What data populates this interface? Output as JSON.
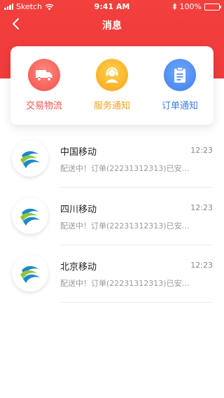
{
  "status_bar": {
    "carrier": "Sketch",
    "time": "9:41 AM",
    "battery": "100%"
  },
  "nav": {
    "title": "消息"
  },
  "categories": [
    {
      "label": "交易物流",
      "icon": "truck-icon",
      "color": "#f0574b"
    },
    {
      "label": "服务通知",
      "icon": "support-agent-icon",
      "color": "#f4a21c"
    },
    {
      "label": "订单通知",
      "icon": "clipboard-icon",
      "color": "#3d7fe6"
    }
  ],
  "messages": [
    {
      "name": "中国移动",
      "time": "12:23",
      "preview": "配送中！订单(22231312313)已安排......",
      "avatar_icon": "china-mobile-logo-icon"
    },
    {
      "name": "四川移动",
      "time": "12:23",
      "preview": "配送中！订单(22231312313)已安排......",
      "avatar_icon": "china-mobile-logo-icon"
    },
    {
      "name": "北京移动",
      "time": "12:23",
      "preview": "配送中！订单(22231312313)已安排......",
      "avatar_icon": "china-mobile-logo-icon"
    }
  ],
  "colors": {
    "header_red": "#ef3b3c"
  }
}
